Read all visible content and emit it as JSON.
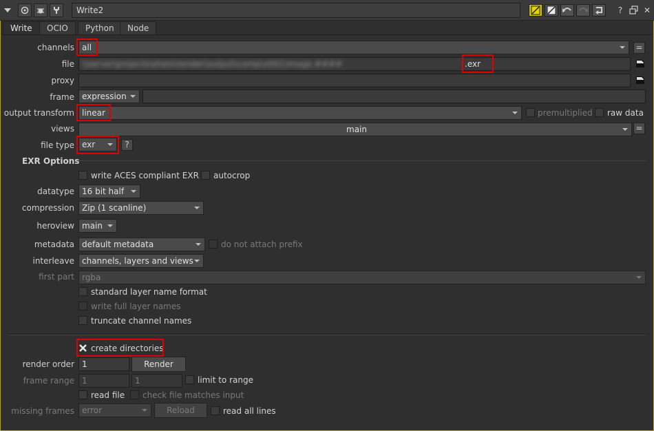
{
  "window": {
    "node_name": "Write2",
    "title_buttons_left": [
      "collapse-icon",
      "viewer-icon",
      "bug-icon",
      "wrench-icon"
    ],
    "title_buttons_right": [
      "color-swatch-icon",
      "color-swatch-2-icon",
      "undo-icon",
      "redo-icon",
      "revert-icon",
      "help-icon",
      "float-icon",
      "close-icon"
    ],
    "help_label": "?",
    "close_label": "✕"
  },
  "tabs": [
    {
      "label": "Write",
      "active": true
    },
    {
      "label": "OCIO",
      "active": false
    },
    {
      "label": "Python",
      "active": false
    },
    {
      "label": "Node",
      "active": false
    }
  ],
  "knobs": {
    "channels": {
      "label": "channels",
      "value": "all",
      "eq_label": "="
    },
    "file": {
      "label": "file",
      "blurred_path": "\\\\server\\projects\\shots\\render\\output\\comp\\v001\\image.####",
      "ext": ".exr"
    },
    "proxy": {
      "label": "proxy",
      "value": ""
    },
    "frame": {
      "label": "frame",
      "mode": "expression",
      "expr": ""
    },
    "output_transform": {
      "label": "output transform",
      "value": "linear",
      "premultiplied_label": "premultiplied",
      "raw_data_label": "raw data"
    },
    "views": {
      "label": "views",
      "value": "main",
      "eq_label": "="
    },
    "file_type": {
      "label": "file type",
      "value": "exr",
      "help": "?"
    }
  },
  "exr_options": {
    "header": "EXR Options",
    "write_aces_label": "write ACES compliant EXR",
    "autocrop_label": "autocrop",
    "datatype": {
      "label": "datatype",
      "value": "16 bit half"
    },
    "compression": {
      "label": "compression",
      "value": "Zip (1 scanline)"
    },
    "heroview": {
      "label": "heroview",
      "value": "main"
    },
    "metadata": {
      "label": "metadata",
      "value": "default metadata",
      "no_prefix_label": "do not attach prefix"
    },
    "interleave": {
      "label": "interleave",
      "value": "channels, layers and views"
    },
    "first_part": {
      "label": "first part",
      "value": "rgba"
    },
    "standard_layer_label": "standard layer name format",
    "write_full_layer_label": "write full layer names",
    "truncate_label": "truncate channel names"
  },
  "render": {
    "create_directories_label": "create directories",
    "create_directories_checked": true,
    "render_order_label": "render order",
    "render_order_value": "1",
    "render_button": "Render",
    "frame_range_label": "frame range",
    "frame_range_start": "1",
    "frame_range_end": "1",
    "limit_to_range_label": "limit to range",
    "read_file_label": "read file",
    "check_file_label": "check file matches input",
    "missing_frames_label": "missing frames",
    "missing_frames_value": "error",
    "reload_button": "Reload",
    "read_all_lines_label": "read all lines"
  },
  "colors": {
    "accent_border": "#c9a200",
    "highlight": "#e00000",
    "panel_bg": "#2f2f2f"
  }
}
